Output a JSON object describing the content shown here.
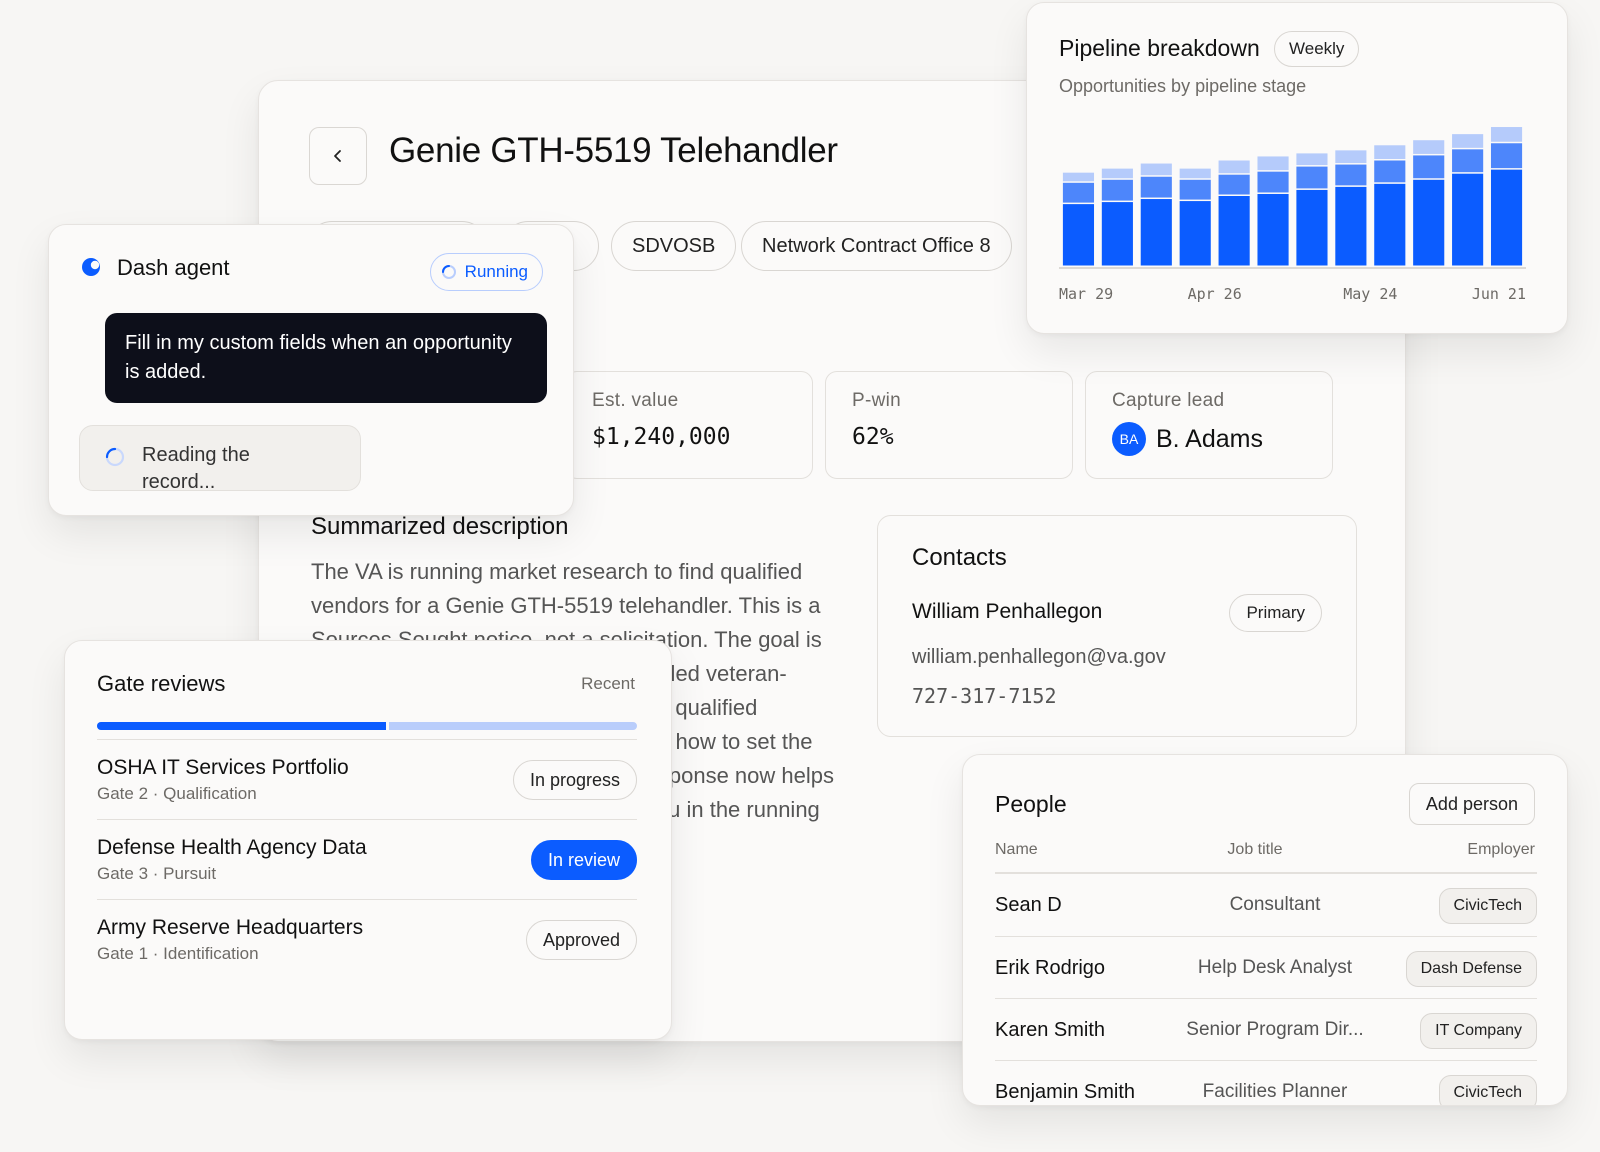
{
  "main": {
    "title": "Genie GTH-5519 Telehandler",
    "tags": [
      "",
      "e",
      "SDVOSB",
      "Network Contract Office 8"
    ],
    "metrics": [
      {
        "label": "Est. value",
        "value": "$1,240,000"
      },
      {
        "label": "P-win",
        "value": "62%"
      }
    ],
    "capture_lead": {
      "label": "Capture lead",
      "initials": "BA",
      "name": "B. Adams"
    },
    "description": {
      "title": "Summarized description",
      "text": "The VA is running market research to find qualified vendors for a Genie GTH-5519 telehandler. This is a Sources Sought notice, not a solicitation. The goal is to see whether enough service-disabled veteran-owned small businesses can provide qualified equipment so the agency can decide how to set the acquisition strategy. Submitting a response now helps shape the requirement and keeps you in the running when the solicitation is released."
    },
    "contacts": {
      "title": "Contacts",
      "name": "William Penhallegon",
      "badge": "Primary",
      "email": "william.penhallegon@va.gov",
      "phone": "727-317-7152"
    }
  },
  "pipeline": {
    "title": "Pipeline breakdown",
    "badge": "Weekly",
    "subtitle": "Opportunities by pipeline stage"
  },
  "chart_data": {
    "type": "bar",
    "stacked": true,
    "title": "Pipeline breakdown",
    "subtitle": "Opportunities by pipeline stage",
    "x_tick_labels": [
      "Mar 29",
      "Apr 26",
      "May 24",
      "Jun 21"
    ],
    "series": [
      {
        "values": [
          62,
          64,
          67,
          65,
          70,
          72,
          76,
          79,
          82,
          86,
          92,
          96
        ]
      },
      {
        "values": [
          21,
          22,
          22,
          21,
          21,
          22,
          23,
          22,
          23,
          24,
          24,
          26
        ]
      },
      {
        "values": [
          10,
          11,
          13,
          11,
          14,
          15,
          13,
          14,
          15,
          15,
          15,
          16
        ]
      }
    ],
    "colors": [
      "#0b5cff",
      "#4d86fb",
      "#b5cbfb"
    ],
    "grid": false
  },
  "agent": {
    "title": "Dash agent",
    "status": "Running",
    "prompt": "Fill in my custom fields when an opportunity is added.",
    "step": "Reading the record..."
  },
  "gates": {
    "title": "Gate reviews",
    "recent": "Recent",
    "progress": 0.54,
    "rows": [
      {
        "name": "OSHA IT Services Portfolio",
        "sub": "Gate 2 · Qualification",
        "status": "In progress"
      },
      {
        "name": "Defense Health Agency Data",
        "sub": "Gate 3 · Pursuit",
        "status": "In review"
      },
      {
        "name": "Army Reserve Headquarters",
        "sub": "Gate 1 · Identification",
        "status": "Approved"
      }
    ]
  },
  "people": {
    "title": "People",
    "add_label": "Add person",
    "headers": {
      "name": "Name",
      "job": "Job title",
      "employer": "Employer"
    },
    "rows": [
      {
        "name": "Sean D",
        "job": "Consultant",
        "employer": "CivicTech"
      },
      {
        "name": "Erik Rodrigo",
        "job": "Help Desk Analyst",
        "employer": "Dash Defense"
      },
      {
        "name": "Karen Smith",
        "job": "Senior Program Dir...",
        "employer": "IT Company"
      },
      {
        "name": "Benjamin Smith",
        "job": "Facilities Planner",
        "employer": "CivicTech"
      }
    ]
  },
  "colors": {
    "accent": "#0b5cff",
    "dark": "#0d0f1a",
    "card": "#fbfaf9"
  }
}
